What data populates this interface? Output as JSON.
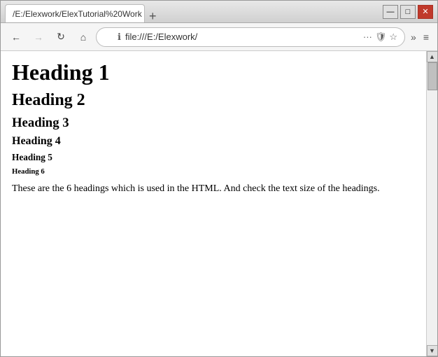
{
  "window": {
    "title_bar": {
      "tab_label": "/E:/Elexwork/ElexTutorial%20Work",
      "tab_close": "×",
      "tab_new": "+",
      "minimize": "—",
      "maximize": "□",
      "close": "✕"
    },
    "nav": {
      "back": "←",
      "forward": "→",
      "refresh": "↻",
      "home": "⌂",
      "address": "file:///E:/Elexwork/",
      "more": "···",
      "shield": "🛡",
      "star": "☆",
      "extend": "»",
      "menu": "≡"
    }
  },
  "content": {
    "h1": "Heading 1",
    "h2": "Heading 2",
    "h3": "Heading 3",
    "h4": "Heading 4",
    "h5": "Heading 5",
    "h6": "Heading 6",
    "paragraph": "These are the 6 headings which is used in the HTML. And check the text size of the headings."
  }
}
